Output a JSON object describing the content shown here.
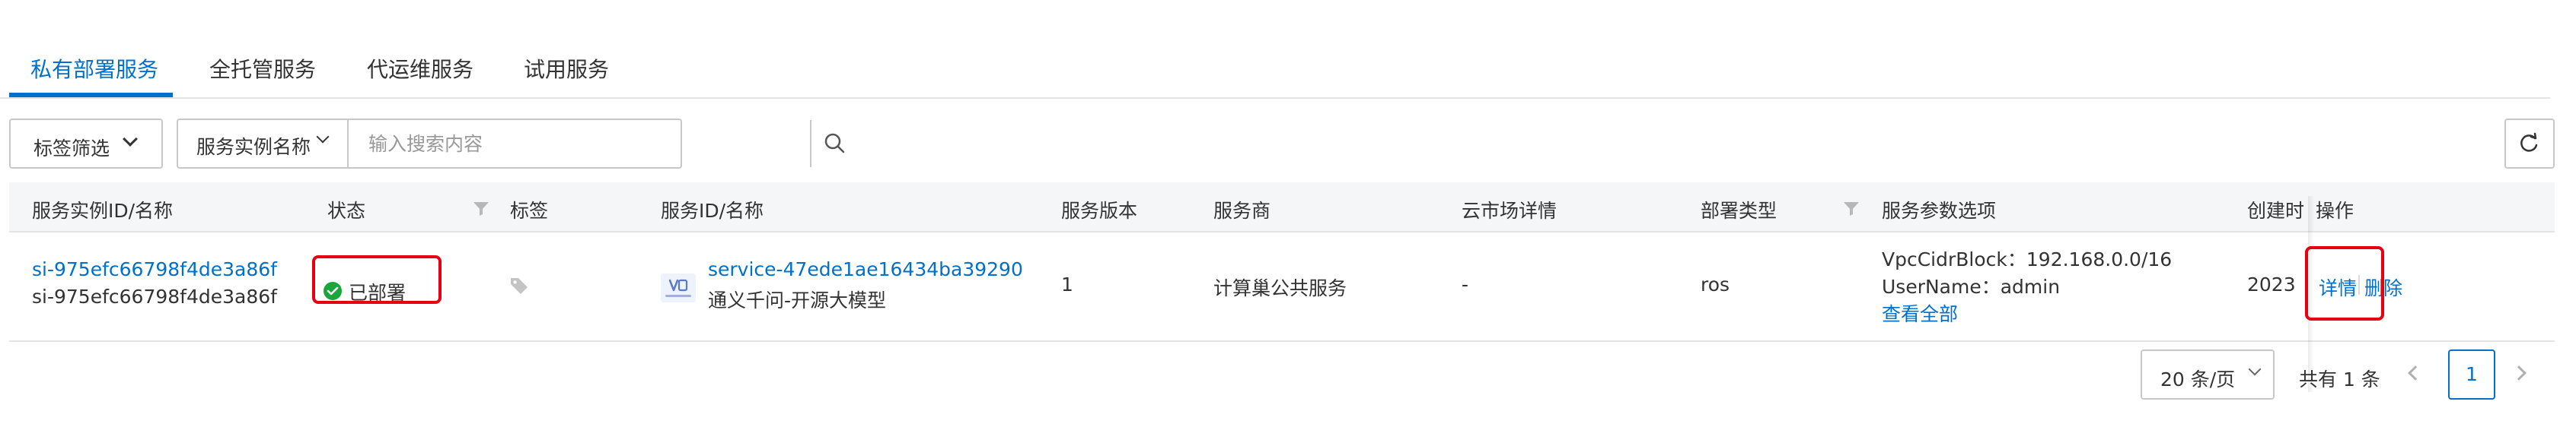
{
  "tabs": [
    {
      "label": "私有部署服务",
      "active": true
    },
    {
      "label": "全托管服务",
      "active": false
    },
    {
      "label": "代运维服务",
      "active": false
    },
    {
      "label": "试用服务",
      "active": false
    }
  ],
  "toolbar": {
    "tag_filter_label": "标签筛选",
    "search_field_label": "服务实例名称",
    "search_placeholder": "输入搜索内容"
  },
  "table": {
    "headers": {
      "instance": "服务实例ID/名称",
      "status": "状态",
      "tags": "标签",
      "service": "服务ID/名称",
      "version": "服务版本",
      "provider": "服务商",
      "market": "云市场详情",
      "deploy_type": "部署类型",
      "params": "服务参数选项",
      "created": "创建时",
      "actions": "操作"
    },
    "rows": [
      {
        "instance_id": "si-975efc66798f4de3a86f",
        "instance_name": "si-975efc66798f4de3a86f",
        "status": "已部署",
        "service_id": "service-47ede1ae16434ba39290",
        "service_name": "通义千问-开源大模型",
        "version": "1",
        "provider": "计算巢公共服务",
        "market": "-",
        "deploy_type": "ros",
        "param_1": "VpcCidrBlock：192.168.0.0/16",
        "param_2": "UserName：admin",
        "view_all": "查看全部",
        "created": "2023",
        "action_detail": "详情",
        "action_delete": "删除"
      }
    ]
  },
  "pagination": {
    "page_size": "20 条/页",
    "total": "共有 1 条",
    "current_page": "1"
  },
  "colors": {
    "accent": "#0070cc",
    "success": "#1aa63a",
    "highlight": "#e60012"
  },
  "icons": [
    "chevron-down-icon",
    "search-icon",
    "refresh-icon",
    "filter-icon",
    "tag-icon",
    "success-check-icon",
    "service-logo-icon",
    "chevron-left-icon",
    "chevron-right-icon"
  ]
}
